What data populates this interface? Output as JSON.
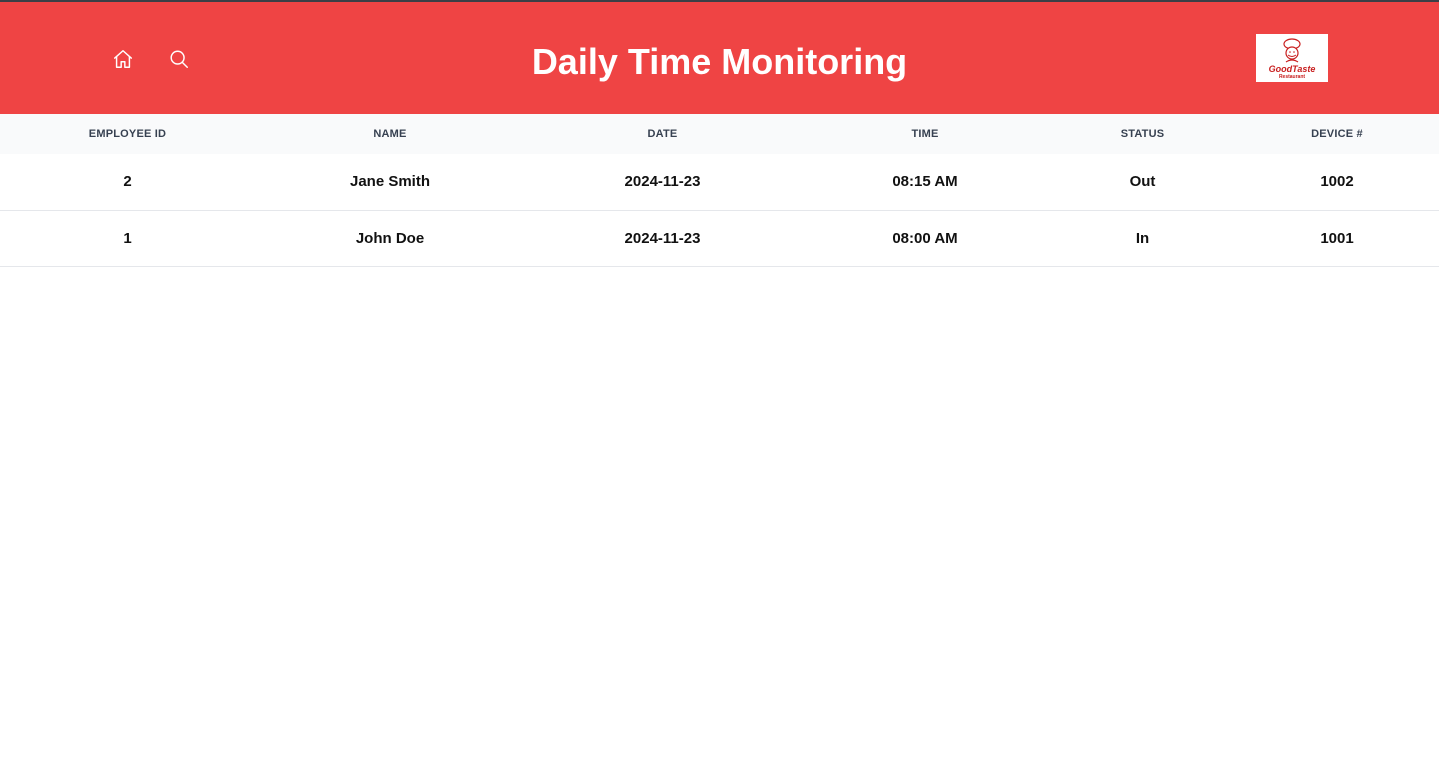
{
  "header": {
    "title": "Daily Time Monitoring",
    "home_icon": "home-icon",
    "search_icon": "search-icon",
    "logo": {
      "brand": "GoodTaste",
      "sub": "Restaurant"
    },
    "colors": {
      "header_bg": "#ef4444",
      "title": "#ffffff"
    }
  },
  "table": {
    "columns": [
      "Employee ID",
      "Name",
      "Date",
      "Time",
      "Status",
      "Device #"
    ],
    "rows": [
      [
        "2",
        "Jane Smith",
        "2024-11-23",
        "08:15 AM",
        "Out",
        "1002"
      ],
      [
        "1",
        "John Doe",
        "2024-11-23",
        "08:00 AM",
        "In",
        "1001"
      ]
    ]
  }
}
